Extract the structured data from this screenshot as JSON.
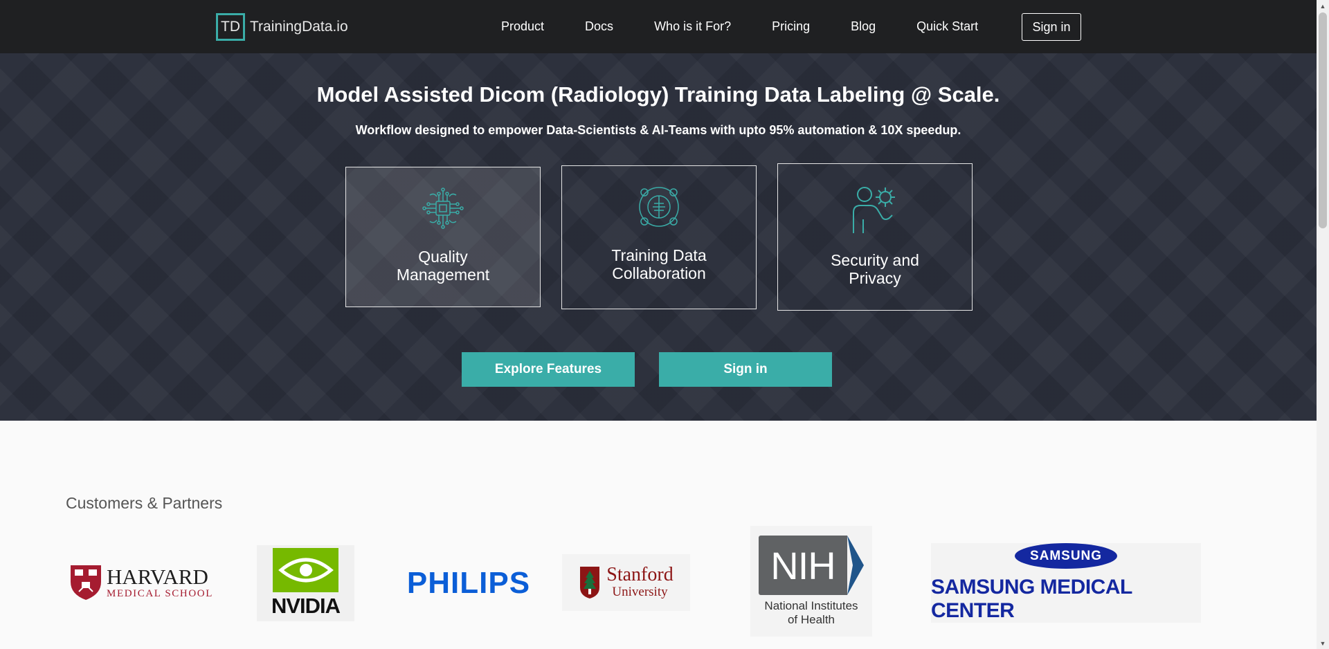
{
  "nav": {
    "logo_mark": "TD",
    "brand": "TrainingData.io",
    "links": [
      "Product",
      "Docs",
      "Who is it For?",
      "Pricing",
      "Blog",
      "Quick Start"
    ],
    "signin": "Sign in"
  },
  "hero": {
    "title": "Model Assisted Dicom (Radiology) Training Data Labeling @ Scale.",
    "subtitle": "Workflow designed to empower Data-Scientists & AI-Teams with upto 95% automation & 10X speedup.",
    "cards": [
      {
        "label": "Quality Management",
        "icon": "circuit-chip-icon"
      },
      {
        "label": "Training Data Collaboration",
        "icon": "collaboration-network-icon"
      },
      {
        "label": "Security and Privacy",
        "icon": "user-shield-icon"
      }
    ],
    "explore_button": "Explore Features",
    "signin_button": "Sign in",
    "accent_color": "#3aada8"
  },
  "partners": {
    "title": "Customers & Partners",
    "logos": {
      "harvard_line1": "HARVARD",
      "harvard_line2": "MEDICAL SCHOOL",
      "nvidia": "NVIDIA",
      "philips": "PHILIPS",
      "stanford_line1": "Stanford",
      "stanford_line2": "University",
      "nih": "NIH",
      "nih_line1": "National Institutes",
      "nih_line2": "of Health",
      "samsung": "SAMSUNG",
      "samsung_center": "SAMSUNG MEDICAL CENTER"
    }
  }
}
